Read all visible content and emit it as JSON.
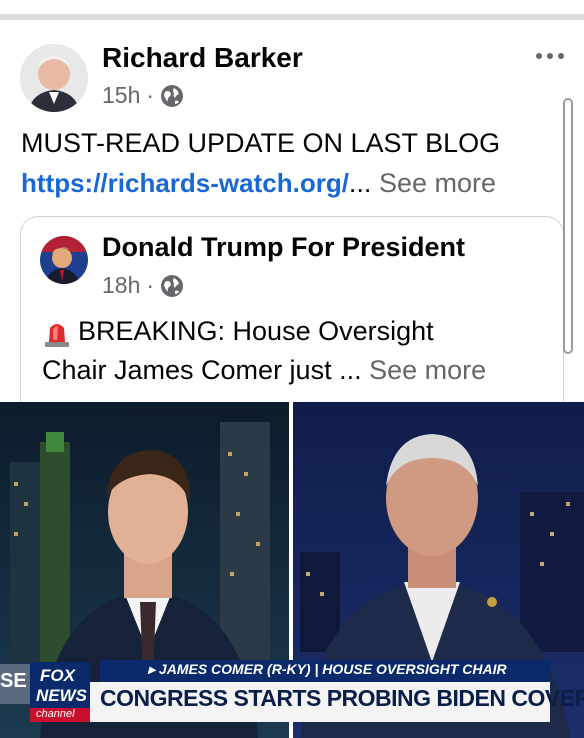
{
  "post": {
    "author": "Richard Barker",
    "time": "15h",
    "separator": "·",
    "text": "MUST-READ UPDATE ON LAST BLOG",
    "link": "https://richards-watch.org/",
    "ellipsis": "...",
    "see_more": "See more"
  },
  "shared": {
    "author": "Donald Trump For President",
    "time": "18h",
    "separator": "·",
    "line1": "BREAKING: House Oversight",
    "line2": "Chair James Comer just",
    "ellipsis": "...",
    "see_more": "See more"
  },
  "image": {
    "chyron_top": "▸ JAMES COMER (R-KY) | HOUSE OVERSIGHT CHAIR",
    "chyron_main": "CONGRESS STARTS PROBING BIDEN COVER-UP",
    "logo_line1": "FOX",
    "logo_line2": "NEWS",
    "logo_line3": "channel",
    "corner_text": "SE"
  },
  "icons": {
    "more": "more-dots-icon",
    "audience": "globe-icon",
    "siren": "police-siren-icon"
  },
  "colors": {
    "link": "#1968d3",
    "meta": "#65676b",
    "fox_blue": "#0a2a6b"
  }
}
